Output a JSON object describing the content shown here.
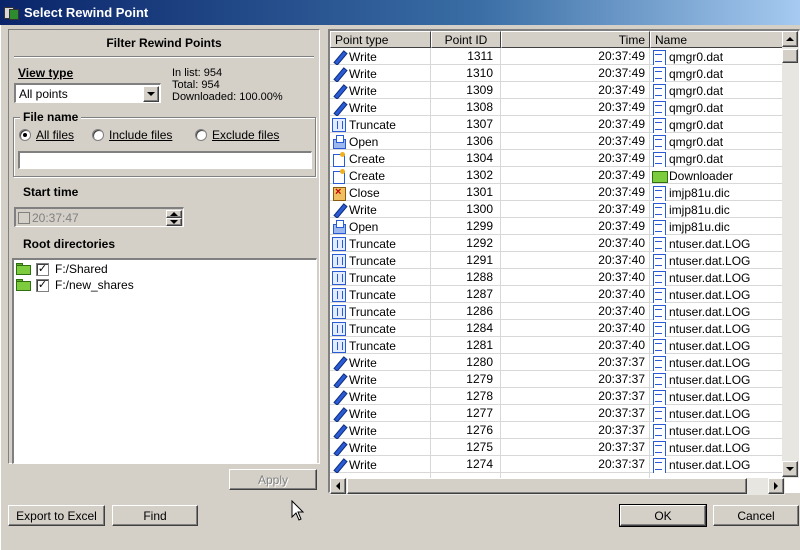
{
  "window": {
    "title": "Select Rewind Point"
  },
  "filter": {
    "title": "Filter Rewind Points",
    "view_type_label": "View type",
    "view_type_value": "All points",
    "stats": {
      "in_list": "In list: 954",
      "total": "Total: 954",
      "downloaded": "Downloaded: 100.00%"
    },
    "file_name_label": "File name",
    "radio_all": "All files",
    "radio_include": "Include files",
    "radio_exclude": "Exclude files",
    "file_name_value": "",
    "start_time_label": "Start time",
    "start_time_value": "20:37:47",
    "root_dirs_label": "Root directories",
    "roots": [
      {
        "path": "F:/Shared",
        "checked": true
      },
      {
        "path": "F:/new_shares",
        "checked": true
      }
    ],
    "apply_label": "Apply"
  },
  "list": {
    "columns": [
      "Point type",
      "Point ID",
      "Time",
      "Name"
    ],
    "rows": [
      {
        "type": "Write",
        "icon": "write-icon",
        "id": "1311",
        "time": "20:37:49",
        "name": "qmgr0.dat",
        "nicon": "file-icon"
      },
      {
        "type": "Write",
        "icon": "write-icon",
        "id": "1310",
        "time": "20:37:49",
        "name": "qmgr0.dat",
        "nicon": "file-icon"
      },
      {
        "type": "Write",
        "icon": "write-icon",
        "id": "1309",
        "time": "20:37:49",
        "name": "qmgr0.dat",
        "nicon": "file-icon"
      },
      {
        "type": "Write",
        "icon": "write-icon",
        "id": "1308",
        "time": "20:37:49",
        "name": "qmgr0.dat",
        "nicon": "file-icon"
      },
      {
        "type": "Truncate",
        "icon": "truncate-icon",
        "id": "1307",
        "time": "20:37:49",
        "name": "qmgr0.dat",
        "nicon": "file-icon"
      },
      {
        "type": "Open",
        "icon": "open-icon",
        "id": "1306",
        "time": "20:37:49",
        "name": "qmgr0.dat",
        "nicon": "file-icon"
      },
      {
        "type": "Create",
        "icon": "create-icon",
        "id": "1304",
        "time": "20:37:49",
        "name": "qmgr0.dat",
        "nicon": "file-icon"
      },
      {
        "type": "Create",
        "icon": "create-icon",
        "id": "1302",
        "time": "20:37:49",
        "name": "Downloader",
        "nicon": "folder-icon"
      },
      {
        "type": "Close",
        "icon": "close-icon",
        "id": "1301",
        "time": "20:37:49",
        "name": "imjp81u.dic",
        "nicon": "file-icon"
      },
      {
        "type": "Write",
        "icon": "write-icon",
        "id": "1300",
        "time": "20:37:49",
        "name": "imjp81u.dic",
        "nicon": "file-icon"
      },
      {
        "type": "Open",
        "icon": "open-icon",
        "id": "1299",
        "time": "20:37:49",
        "name": "imjp81u.dic",
        "nicon": "file-icon"
      },
      {
        "type": "Truncate",
        "icon": "truncate-icon",
        "id": "1292",
        "time": "20:37:40",
        "name": "ntuser.dat.LOG",
        "nicon": "file-icon"
      },
      {
        "type": "Truncate",
        "icon": "truncate-icon",
        "id": "1291",
        "time": "20:37:40",
        "name": "ntuser.dat.LOG",
        "nicon": "file-icon"
      },
      {
        "type": "Truncate",
        "icon": "truncate-icon",
        "id": "1288",
        "time": "20:37:40",
        "name": "ntuser.dat.LOG",
        "nicon": "file-icon"
      },
      {
        "type": "Truncate",
        "icon": "truncate-icon",
        "id": "1287",
        "time": "20:37:40",
        "name": "ntuser.dat.LOG",
        "nicon": "file-icon"
      },
      {
        "type": "Truncate",
        "icon": "truncate-icon",
        "id": "1286",
        "time": "20:37:40",
        "name": "ntuser.dat.LOG",
        "nicon": "file-icon"
      },
      {
        "type": "Truncate",
        "icon": "truncate-icon",
        "id": "1284",
        "time": "20:37:40",
        "name": "ntuser.dat.LOG",
        "nicon": "file-icon"
      },
      {
        "type": "Truncate",
        "icon": "truncate-icon",
        "id": "1281",
        "time": "20:37:40",
        "name": "ntuser.dat.LOG",
        "nicon": "file-icon"
      },
      {
        "type": "Write",
        "icon": "write-icon",
        "id": "1280",
        "time": "20:37:37",
        "name": "ntuser.dat.LOG",
        "nicon": "file-icon"
      },
      {
        "type": "Write",
        "icon": "write-icon",
        "id": "1279",
        "time": "20:37:37",
        "name": "ntuser.dat.LOG",
        "nicon": "file-icon"
      },
      {
        "type": "Write",
        "icon": "write-icon",
        "id": "1278",
        "time": "20:37:37",
        "name": "ntuser.dat.LOG",
        "nicon": "file-icon"
      },
      {
        "type": "Write",
        "icon": "write-icon",
        "id": "1277",
        "time": "20:37:37",
        "name": "ntuser.dat.LOG",
        "nicon": "file-icon"
      },
      {
        "type": "Write",
        "icon": "write-icon",
        "id": "1276",
        "time": "20:37:37",
        "name": "ntuser.dat.LOG",
        "nicon": "file-icon"
      },
      {
        "type": "Write",
        "icon": "write-icon",
        "id": "1275",
        "time": "20:37:37",
        "name": "ntuser.dat.LOG",
        "nicon": "file-icon"
      },
      {
        "type": "Write",
        "icon": "write-icon",
        "id": "1274",
        "time": "20:37:37",
        "name": "ntuser.dat.LOG",
        "nicon": "file-icon"
      }
    ]
  },
  "buttons": {
    "export": "Export to Excel",
    "find": "Find",
    "ok": "OK",
    "cancel": "Cancel"
  }
}
